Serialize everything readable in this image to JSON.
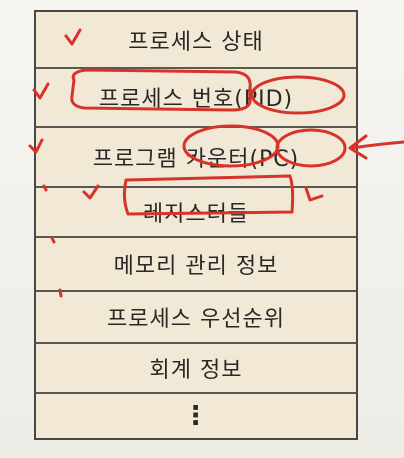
{
  "pcb": {
    "fields": [
      {
        "label": "프로세스 상태"
      },
      {
        "label": "프로세스 번호(PID)"
      },
      {
        "label": "프로그램 카운터(PC)"
      },
      {
        "label": "레지스터들"
      },
      {
        "label": "메모리 관리 정보"
      },
      {
        "label": "프로세스 우선순위"
      },
      {
        "label": "회계 정보"
      },
      {
        "label": "⋮"
      }
    ]
  },
  "annotation_color": "#d8332b",
  "annotations": {
    "checkmarks": 6,
    "circled_terms": [
      "프로세스 번호",
      "PID",
      "카운터",
      "PC",
      "레지스터들"
    ],
    "arrow_target": "PC"
  }
}
